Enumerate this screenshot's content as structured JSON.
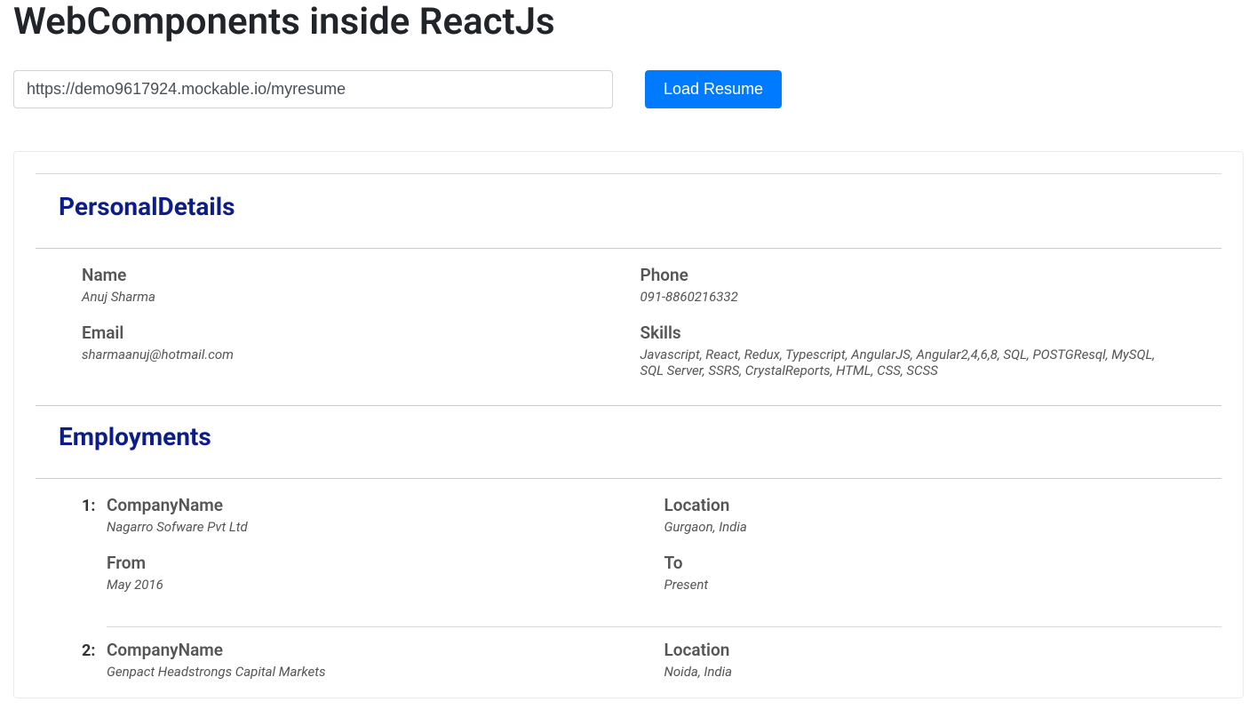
{
  "header": {
    "title": "WebComponents inside ReactJs"
  },
  "form": {
    "url_value": "https://demo9617924.mockable.io/myresume",
    "load_button_label": "Load Resume"
  },
  "sections": {
    "personal_title": "PersonalDetails",
    "employments_title": "Employments"
  },
  "personal": {
    "name_label": "Name",
    "name_value": "Anuj Sharma",
    "email_label": "Email",
    "email_value": "sharmaanuj@hotmail.com",
    "phone_label": "Phone",
    "phone_value": "091-8860216332",
    "skills_label": "Skills",
    "skills_value": "Javascript, React, Redux, Typescript, AngularJS, Angular2,4,6,8, SQL, POSTGResql, MySQL, SQL Server, SSRS, CrystalReports, HTML, CSS, SCSS"
  },
  "employments": [
    {
      "num": "1:",
      "company_label": "CompanyName",
      "company_value": "Nagarro Sofware Pvt Ltd",
      "location_label": "Location",
      "location_value": "Gurgaon, India",
      "from_label": "From",
      "from_value": "May 2016",
      "to_label": "To",
      "to_value": "Present"
    },
    {
      "num": "2:",
      "company_label": "CompanyName",
      "company_value": "Genpact Headstrongs Capital Markets",
      "location_label": "Location",
      "location_value": "Noida, India"
    }
  ]
}
